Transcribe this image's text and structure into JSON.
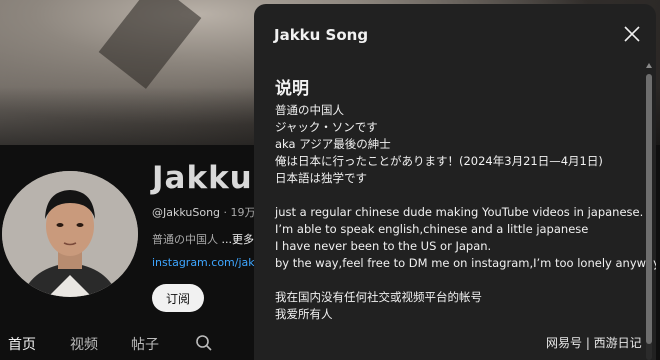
{
  "channel": {
    "name": "Jakku S",
    "handle": "@JakkuSong",
    "stats": "· 19万",
    "description_preview": "普通の中国人",
    "more_label": "...更多",
    "link": "instagram.com/jak",
    "subscribe_label": "订阅"
  },
  "tabs": [
    {
      "label": "首页",
      "active": true
    },
    {
      "label": "视频",
      "active": false
    },
    {
      "label": "帖子",
      "active": false
    }
  ],
  "search_icon": "search-icon",
  "about_dialog": {
    "title": "Jakku Song",
    "close_icon": "close-icon",
    "section_heading": "说明",
    "description_lines": [
      "普通の中国人",
      "ジャック・ソンです",
      "aka アジア最後の紳士",
      "俺は日本に行ったことがあります！(2024年3月21日—4月1日)",
      "日本語は独学です",
      "",
      "just a regular chinese dude making YouTube videos in japanese.",
      "I’m able to speak english,chinese and a little japanese",
      "I have never been to the US or Japan.",
      "by the way,feel free to DM me on instagram,I’m too lonely anyway.",
      "",
      "我在国内没有任何社交或视频平台的帐号",
      "我爱所有人"
    ]
  },
  "watermark": "网易号 | 西游日记",
  "colors": {
    "background": "#0f0f0f",
    "dialog": "#212121",
    "link": "#3ea6ff",
    "text": "#f1f1f1"
  }
}
